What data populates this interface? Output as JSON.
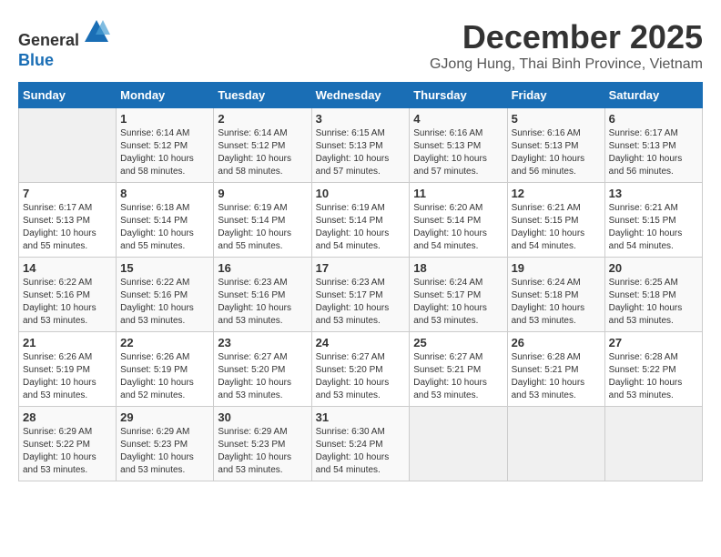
{
  "header": {
    "logo_line1": "General",
    "logo_line2": "Blue",
    "month": "December 2025",
    "location": "GJong Hung, Thai Binh Province, Vietnam"
  },
  "days_of_week": [
    "Sunday",
    "Monday",
    "Tuesday",
    "Wednesday",
    "Thursday",
    "Friday",
    "Saturday"
  ],
  "weeks": [
    [
      {
        "num": "",
        "info": ""
      },
      {
        "num": "1",
        "info": "Sunrise: 6:14 AM\nSunset: 5:12 PM\nDaylight: 10 hours\nand 58 minutes."
      },
      {
        "num": "2",
        "info": "Sunrise: 6:14 AM\nSunset: 5:12 PM\nDaylight: 10 hours\nand 58 minutes."
      },
      {
        "num": "3",
        "info": "Sunrise: 6:15 AM\nSunset: 5:13 PM\nDaylight: 10 hours\nand 57 minutes."
      },
      {
        "num": "4",
        "info": "Sunrise: 6:16 AM\nSunset: 5:13 PM\nDaylight: 10 hours\nand 57 minutes."
      },
      {
        "num": "5",
        "info": "Sunrise: 6:16 AM\nSunset: 5:13 PM\nDaylight: 10 hours\nand 56 minutes."
      },
      {
        "num": "6",
        "info": "Sunrise: 6:17 AM\nSunset: 5:13 PM\nDaylight: 10 hours\nand 56 minutes."
      }
    ],
    [
      {
        "num": "7",
        "info": "Sunrise: 6:17 AM\nSunset: 5:13 PM\nDaylight: 10 hours\nand 55 minutes."
      },
      {
        "num": "8",
        "info": "Sunrise: 6:18 AM\nSunset: 5:14 PM\nDaylight: 10 hours\nand 55 minutes."
      },
      {
        "num": "9",
        "info": "Sunrise: 6:19 AM\nSunset: 5:14 PM\nDaylight: 10 hours\nand 55 minutes."
      },
      {
        "num": "10",
        "info": "Sunrise: 6:19 AM\nSunset: 5:14 PM\nDaylight: 10 hours\nand 54 minutes."
      },
      {
        "num": "11",
        "info": "Sunrise: 6:20 AM\nSunset: 5:14 PM\nDaylight: 10 hours\nand 54 minutes."
      },
      {
        "num": "12",
        "info": "Sunrise: 6:21 AM\nSunset: 5:15 PM\nDaylight: 10 hours\nand 54 minutes."
      },
      {
        "num": "13",
        "info": "Sunrise: 6:21 AM\nSunset: 5:15 PM\nDaylight: 10 hours\nand 54 minutes."
      }
    ],
    [
      {
        "num": "14",
        "info": "Sunrise: 6:22 AM\nSunset: 5:16 PM\nDaylight: 10 hours\nand 53 minutes."
      },
      {
        "num": "15",
        "info": "Sunrise: 6:22 AM\nSunset: 5:16 PM\nDaylight: 10 hours\nand 53 minutes."
      },
      {
        "num": "16",
        "info": "Sunrise: 6:23 AM\nSunset: 5:16 PM\nDaylight: 10 hours\nand 53 minutes."
      },
      {
        "num": "17",
        "info": "Sunrise: 6:23 AM\nSunset: 5:17 PM\nDaylight: 10 hours\nand 53 minutes."
      },
      {
        "num": "18",
        "info": "Sunrise: 6:24 AM\nSunset: 5:17 PM\nDaylight: 10 hours\nand 53 minutes."
      },
      {
        "num": "19",
        "info": "Sunrise: 6:24 AM\nSunset: 5:18 PM\nDaylight: 10 hours\nand 53 minutes."
      },
      {
        "num": "20",
        "info": "Sunrise: 6:25 AM\nSunset: 5:18 PM\nDaylight: 10 hours\nand 53 minutes."
      }
    ],
    [
      {
        "num": "21",
        "info": "Sunrise: 6:26 AM\nSunset: 5:19 PM\nDaylight: 10 hours\nand 53 minutes."
      },
      {
        "num": "22",
        "info": "Sunrise: 6:26 AM\nSunset: 5:19 PM\nDaylight: 10 hours\nand 52 minutes."
      },
      {
        "num": "23",
        "info": "Sunrise: 6:27 AM\nSunset: 5:20 PM\nDaylight: 10 hours\nand 53 minutes."
      },
      {
        "num": "24",
        "info": "Sunrise: 6:27 AM\nSunset: 5:20 PM\nDaylight: 10 hours\nand 53 minutes."
      },
      {
        "num": "25",
        "info": "Sunrise: 6:27 AM\nSunset: 5:21 PM\nDaylight: 10 hours\nand 53 minutes."
      },
      {
        "num": "26",
        "info": "Sunrise: 6:28 AM\nSunset: 5:21 PM\nDaylight: 10 hours\nand 53 minutes."
      },
      {
        "num": "27",
        "info": "Sunrise: 6:28 AM\nSunset: 5:22 PM\nDaylight: 10 hours\nand 53 minutes."
      }
    ],
    [
      {
        "num": "28",
        "info": "Sunrise: 6:29 AM\nSunset: 5:22 PM\nDaylight: 10 hours\nand 53 minutes."
      },
      {
        "num": "29",
        "info": "Sunrise: 6:29 AM\nSunset: 5:23 PM\nDaylight: 10 hours\nand 53 minutes."
      },
      {
        "num": "30",
        "info": "Sunrise: 6:29 AM\nSunset: 5:23 PM\nDaylight: 10 hours\nand 53 minutes."
      },
      {
        "num": "31",
        "info": "Sunrise: 6:30 AM\nSunset: 5:24 PM\nDaylight: 10 hours\nand 54 minutes."
      },
      {
        "num": "",
        "info": ""
      },
      {
        "num": "",
        "info": ""
      },
      {
        "num": "",
        "info": ""
      }
    ]
  ]
}
